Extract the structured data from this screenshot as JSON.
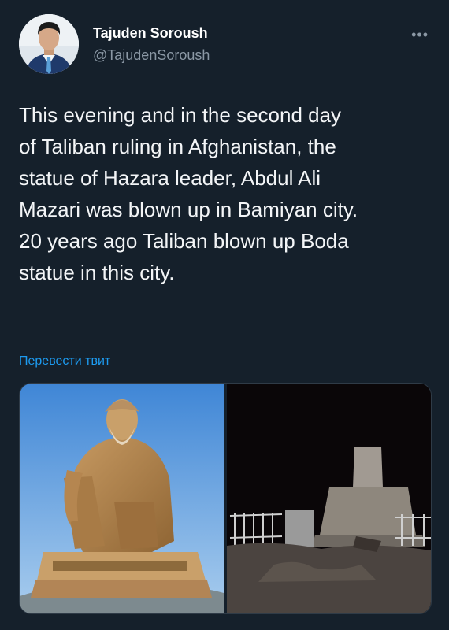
{
  "tweet": {
    "author_name": "Tajuden Soroush",
    "author_handle": "@TajudenSoroush",
    "text": "This evening and in the second day\nof Taliban ruling in Afghanistan, the\nstatue of Hazara leader, Abdul Ali\nMazari was blown up in Bamiyan city.\n20 years ago Taliban blown up Boda\nstatue in this city.",
    "translate_label": "Перевести твит",
    "more_label": "•••"
  },
  "colors": {
    "background": "#15202b",
    "link": "#1d9bf0",
    "secondary_text": "#8b98a5"
  }
}
